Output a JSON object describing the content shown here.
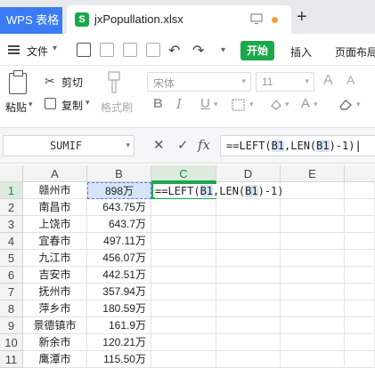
{
  "titlebar": {
    "app_tab": "WPS 表格",
    "file_icon": "S",
    "file_name": "jxPopullation.xlsx",
    "plus": "+"
  },
  "menubar": {
    "file_label": "文件",
    "start_label": "开始",
    "insert_label": "插入",
    "layout_label": "页面布局"
  },
  "ribbon": {
    "paste_label": "粘贴",
    "cut_label": "剪切",
    "copy_label": "复制",
    "format_painter_label": "格式刷",
    "font_name": "宋体",
    "font_size": "11",
    "bold": "B",
    "italic": "I",
    "underline": "U",
    "grow": "A",
    "shrink": "A"
  },
  "formulabar": {
    "namebox_value": "SUMIF",
    "formula_prefix": "==LEFT(",
    "ref1": "B1",
    "formula_mid": ",LEN(",
    "ref2": "B1",
    "formula_suffix": ")-1)"
  },
  "grid": {
    "columns": [
      "A",
      "B",
      "C",
      "D",
      "E"
    ],
    "active_column": "C",
    "active_row": 1,
    "rows": [
      {
        "n": "1",
        "a": "赣州市",
        "b": "898万"
      },
      {
        "n": "2",
        "a": "南昌市",
        "b": "643.75万"
      },
      {
        "n": "3",
        "a": "上饶市",
        "b": "643.7万"
      },
      {
        "n": "4",
        "a": "宜春市",
        "b": "497.11万"
      },
      {
        "n": "5",
        "a": "九江市",
        "b": "456.07万"
      },
      {
        "n": "6",
        "a": "吉安市",
        "b": "442.51万"
      },
      {
        "n": "7",
        "a": "抚州市",
        "b": "357.94万"
      },
      {
        "n": "8",
        "a": "萍乡市",
        "b": "180.59万"
      },
      {
        "n": "9",
        "a": "景德镇市",
        "b": "161.9万"
      },
      {
        "n": "10",
        "a": "新余市",
        "b": "120.21万"
      },
      {
        "n": "11",
        "a": "鹰潭市",
        "b": "115.50万"
      }
    ]
  },
  "colors": {
    "accent_green": "#1aa84a",
    "wps_blue": "#3b7cf5",
    "ref_highlight": "#d6e3f8"
  }
}
